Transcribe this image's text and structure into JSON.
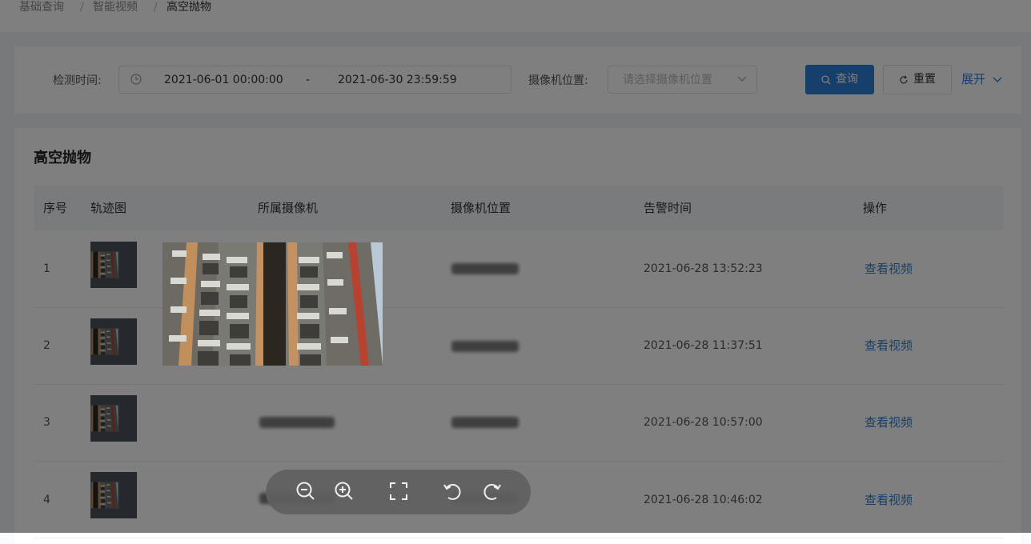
{
  "breadcrumb": [
    "基础查询",
    "智能视频",
    "高空抛物"
  ],
  "breadcrumb_separator": "/",
  "filter": {
    "time_label": "检测时间:",
    "start_time": "2021-06-01 00:00:00",
    "range_separator": "-",
    "end_time": "2021-06-30 23:59:59",
    "camera_location_label": "摄像机位置:",
    "camera_location_placeholder": "请选择摄像机位置",
    "query_button": "查询",
    "reset_button": "重置",
    "expand_button": "展开"
  },
  "table": {
    "title": "高空抛物",
    "columns": [
      "序号",
      "轨迹图",
      "所属摄像机",
      "摄像机位置",
      "告警时间",
      "操作"
    ],
    "rows": [
      {
        "index": "1",
        "alarm_time": "2021-06-28 13:52:23",
        "action": "查看视频"
      },
      {
        "index": "2",
        "alarm_time": "2021-06-28 11:37:51",
        "action": "查看视频"
      },
      {
        "index": "3",
        "alarm_time": "2021-06-28 10:57:00",
        "action": "查看视频"
      },
      {
        "index": "4",
        "alarm_time": "2021-06-28 10:46:02",
        "action": "查看视频"
      }
    ]
  },
  "viewer": {
    "tools": [
      "zoom-out-icon",
      "zoom-in-icon",
      "fullscreen-icon",
      "rotate-left-icon",
      "rotate-right-icon"
    ]
  },
  "colors": {
    "primary": "#2f7fd6",
    "overlay": "rgba(0,0,0,0.5)"
  }
}
